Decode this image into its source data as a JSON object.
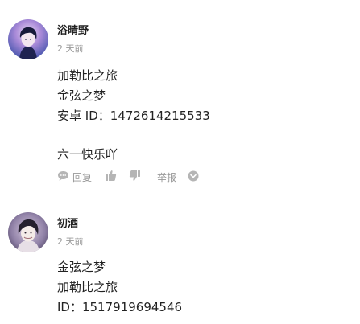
{
  "comments": [
    {
      "username": "浴晴野",
      "time": "2 天前",
      "lines": [
        "加勒比之旅",
        "金弦之梦",
        "安卓 ID：1472614215533",
        "",
        "六一快乐吖"
      ],
      "actions": {
        "reply_label": "回复",
        "report_label": "举报"
      },
      "icons": {
        "reply": "chat-bubble-icon",
        "like": "thumbs-up-icon",
        "dislike": "thumbs-down-icon",
        "more": "chevron-down-circle-icon"
      }
    },
    {
      "username": "初酒",
      "time": "2 天前",
      "lines": [
        "金弦之梦",
        "加勒比之旅",
        "ID：1517919694546"
      ]
    }
  ],
  "colors": {
    "text": "#222222",
    "muted": "#999999",
    "divider": "#ebebeb"
  }
}
